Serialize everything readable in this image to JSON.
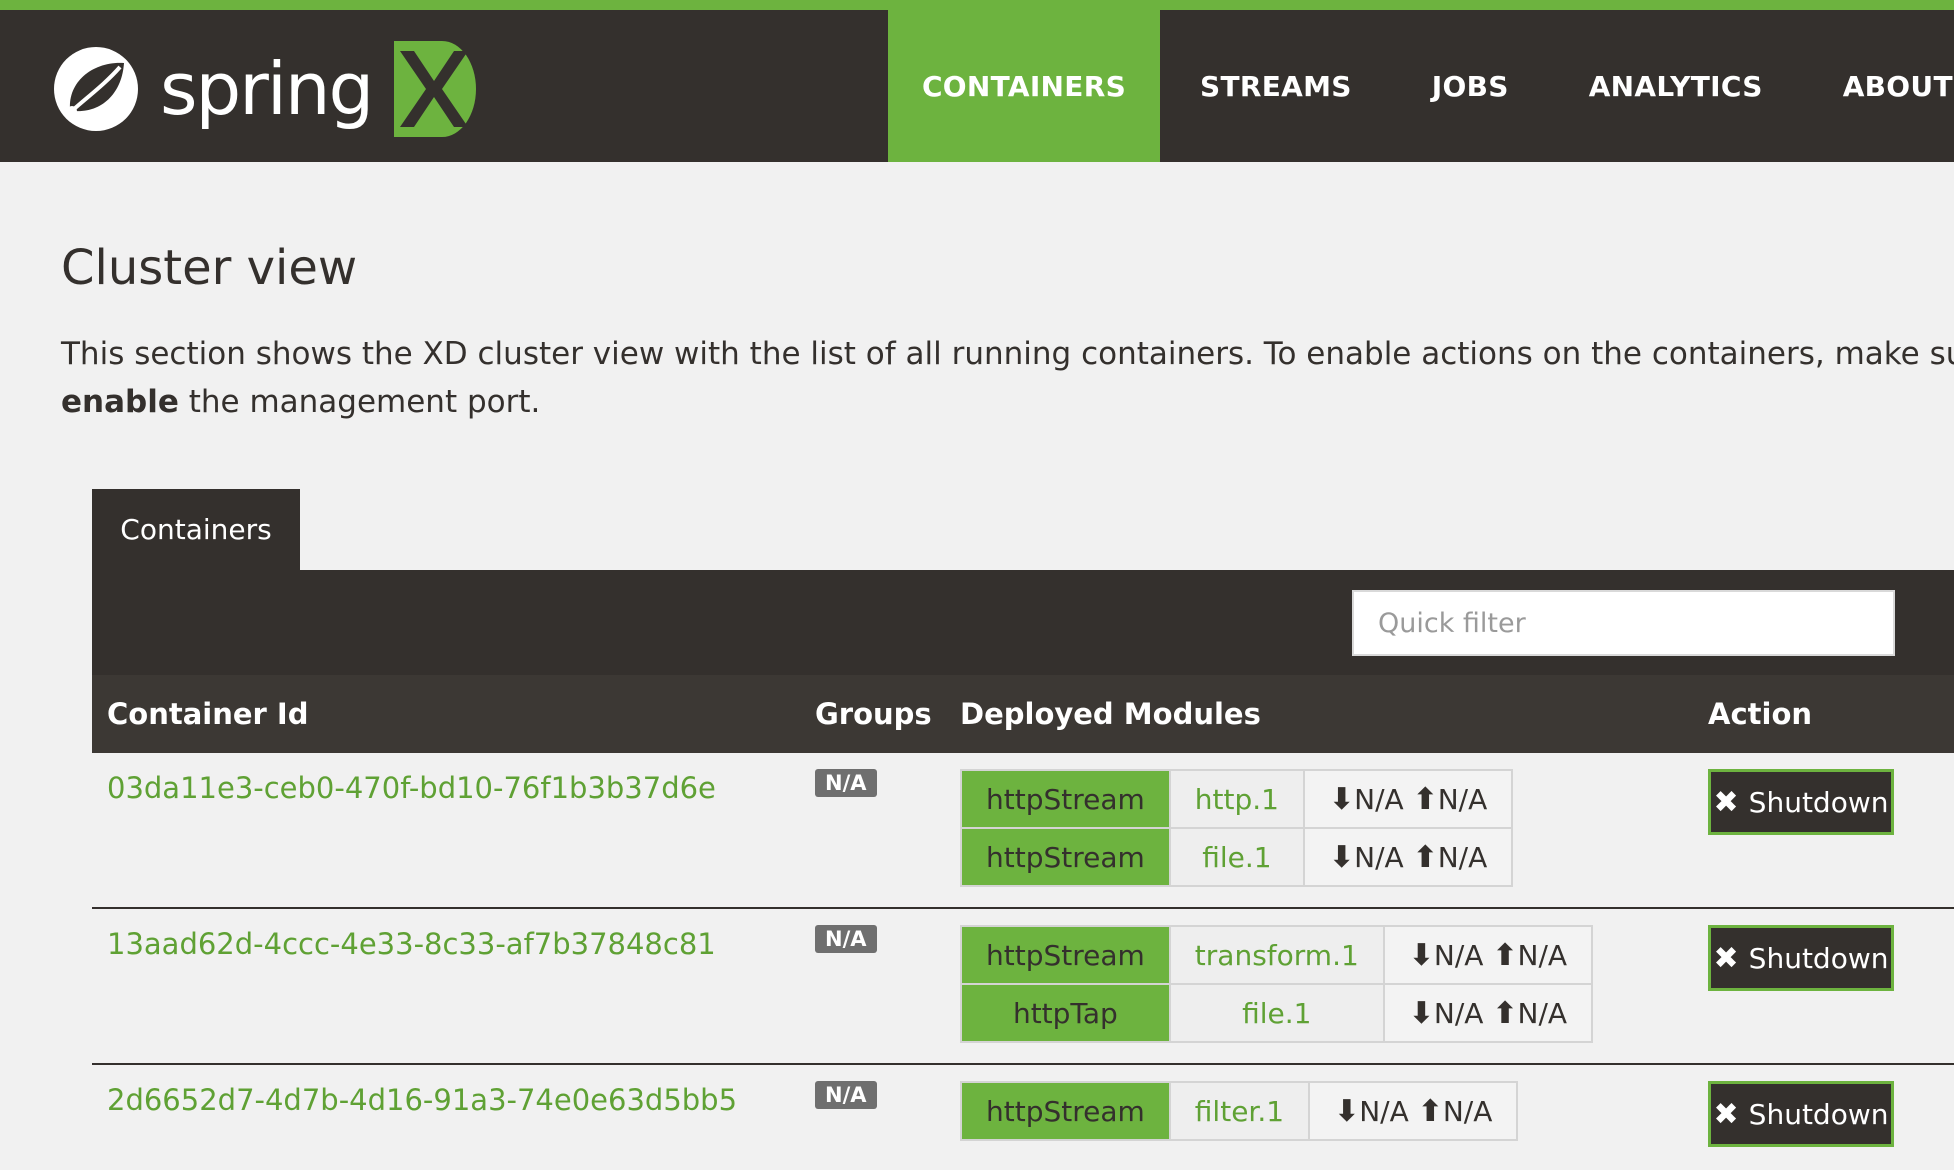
{
  "brand": {
    "name": "spring",
    "accent": "#6db33f",
    "dark": "#34302d"
  },
  "nav": [
    {
      "label": "CONTAINERS",
      "active": true
    },
    {
      "label": "STREAMS"
    },
    {
      "label": "JOBS"
    },
    {
      "label": "ANALYTICS"
    },
    {
      "label": "ABOUT"
    }
  ],
  "page": {
    "title": "Cluster view",
    "desc_line1": "This section shows the XD cluster view with the list of all running containers. To enable actions on the containers, make sure t",
    "desc_bold": "enable",
    "desc_rest": " the management port."
  },
  "panel": {
    "tab_label": "Containers",
    "filter_placeholder": "Quick filter",
    "headers": {
      "id": "Container Id",
      "groups": "Groups",
      "modules": "Deployed Modules",
      "action": "Action"
    }
  },
  "containers": [
    {
      "id": "03da11e3-ceb0-470f-bd10-76f1b3b37d6e",
      "groups": "N/A",
      "modules": [
        {
          "stream": "httpStream",
          "module": "http.1",
          "in": "N/A",
          "out": "N/A"
        },
        {
          "stream": "httpStream",
          "module": "file.1",
          "in": "N/A",
          "out": "N/A"
        }
      ],
      "action": "Shutdown"
    },
    {
      "id": "13aad62d-4ccc-4e33-8c33-af7b37848c81",
      "groups": "N/A",
      "modules": [
        {
          "stream": "httpStream",
          "module": "transform.1",
          "in": "N/A",
          "out": "N/A"
        },
        {
          "stream": "httpTap",
          "module": "file.1",
          "in": "N/A",
          "out": "N/A"
        }
      ],
      "action": "Shutdown"
    },
    {
      "id": "2d6652d7-4d7b-4d16-91a3-74e0e63d5bb5",
      "groups": "N/A",
      "modules": [
        {
          "stream": "httpStream",
          "module": "filter.1",
          "in": "N/A",
          "out": "N/A"
        }
      ],
      "action": "Shutdown"
    }
  ]
}
